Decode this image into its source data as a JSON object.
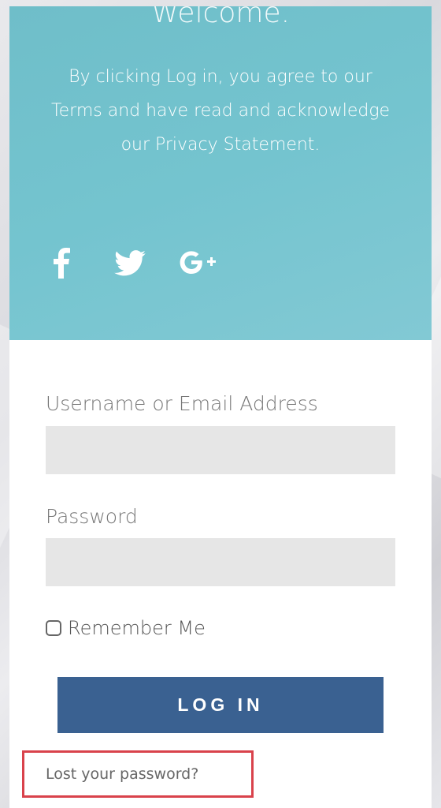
{
  "header": {
    "welcome": "Welcome.",
    "agreement": "By clicking Log in, you agree to our Terms and have read and acknowledge our Privacy Statement."
  },
  "social": [
    {
      "icon": "facebook-icon"
    },
    {
      "icon": "twitter-icon"
    },
    {
      "icon": "google-plus-icon"
    }
  ],
  "form": {
    "username_label": "Username or Email Address",
    "username_value": "",
    "password_label": "Password",
    "password_value": "",
    "remember_label": "Remember Me",
    "remember_checked": false,
    "login_label": "LOG IN",
    "lost_password": "Lost your password?"
  },
  "colors": {
    "header": "#74c4cf",
    "button": "#3a6191",
    "highlight": "#d9424b"
  }
}
